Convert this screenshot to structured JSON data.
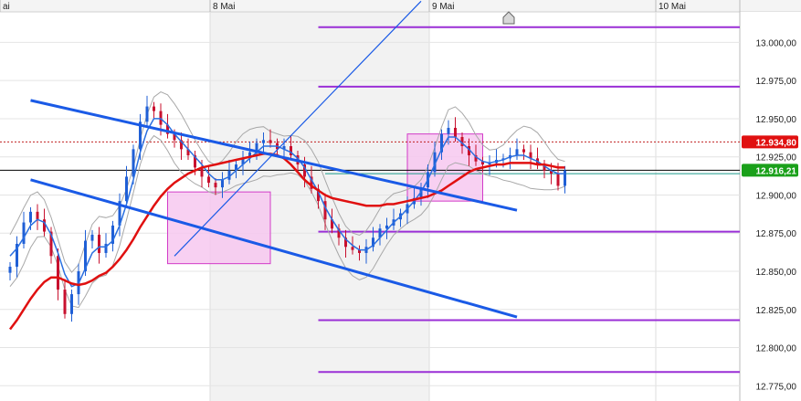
{
  "chart_data": {
    "type": "candlestick",
    "x_labels": [
      "ai",
      "8 Mai",
      "9 Mai",
      "10 Mai"
    ],
    "y_ticks": [
      "13.000,00",
      "12.975,00",
      "12.950,00",
      "12.925,00",
      "12.900,00",
      "12.875,00",
      "12.850,00",
      "12.825,00",
      "12.800,00",
      "12.775,00"
    ],
    "ylim": [
      12765,
      13020
    ],
    "current_price": 12916.21,
    "current_price_label": "12.916,21",
    "marker_price": 12934.8,
    "marker_price_label": "12.934,80",
    "grid": true,
    "colors": {
      "up_candle": "#1f5fd6",
      "down_candle": "#c8102e",
      "moving_average_slow": "#e01010",
      "moving_average_fast": "#2a6fe0",
      "bollinger_band": "#a8a8a8",
      "trend_channel": "#1a5ae6",
      "fib_levels": "#9a2fd6",
      "rectangle_fill": "#f7c8f0",
      "rectangle_stroke": "#d23cc8",
      "current_price_badge": "#1aa01a",
      "marker_badge": "#e01010"
    },
    "series": {
      "close": [
        12853,
        12868,
        12882,
        12889,
        12884,
        12876,
        12860,
        12838,
        12822,
        12835,
        12850,
        12870,
        12874,
        12862,
        12868,
        12880,
        12896,
        12912,
        12930,
        12948,
        12958,
        12955,
        12946,
        12940,
        12936,
        12930,
        12926,
        12918,
        12912,
        12908,
        12905,
        12910,
        12916,
        12920,
        12924,
        12928,
        12934,
        12936,
        12934,
        12930,
        12932,
        12926,
        12920,
        12912,
        12904,
        12896,
        12884,
        12878,
        12872,
        12866,
        12864,
        12862,
        12866,
        12872,
        12878,
        12880,
        12884,
        12888,
        12894,
        12898,
        12905,
        12915,
        12928,
        12940,
        12944,
        12938,
        12932,
        12926,
        12922,
        12920,
        12921,
        12923,
        12924,
        12926,
        12930,
        12928,
        12924,
        12920,
        12916,
        12914,
        12906,
        12916
      ],
      "ma_fast": [
        12860,
        12865,
        12872,
        12880,
        12884,
        12882,
        12874,
        12862,
        12848,
        12840,
        12842,
        12852,
        12862,
        12866,
        12866,
        12870,
        12880,
        12894,
        12910,
        12928,
        12942,
        12950,
        12950,
        12946,
        12940,
        12935,
        12930,
        12925,
        12920,
        12914,
        12910,
        12910,
        12912,
        12916,
        12920,
        12924,
        12928,
        12932,
        12932,
        12932,
        12930,
        12928,
        12924,
        12918,
        12910,
        12902,
        12892,
        12884,
        12877,
        12871,
        12867,
        12864,
        12864,
        12867,
        12872,
        12877,
        12882,
        12886,
        12891,
        12896,
        12902,
        12910,
        12920,
        12930,
        12938,
        12938,
        12934,
        12930,
        12925,
        12922,
        12921,
        12922,
        12923,
        12925,
        12926,
        12926,
        12924,
        12922,
        12919,
        12916,
        12914,
        12914
      ],
      "ma_slow": [
        12812,
        12818,
        12825,
        12832,
        12838,
        12843,
        12846,
        12846,
        12844,
        12842,
        12841,
        12842,
        12844,
        12847,
        12849,
        12853,
        12858,
        12864,
        12871,
        12879,
        12886,
        12893,
        12899,
        12904,
        12908,
        12911,
        12914,
        12916,
        12918,
        12919,
        12920,
        12921,
        12922,
        12923,
        12924,
        12925,
        12926,
        12927,
        12927,
        12926,
        12924,
        12920,
        12915,
        12910,
        12906,
        12903,
        12900,
        12898,
        12897,
        12896,
        12895,
        12894,
        12893,
        12893,
        12893,
        12894,
        12894,
        12895,
        12896,
        12897,
        12898,
        12899,
        12901,
        12903,
        12906,
        12909,
        12912,
        12915,
        12917,
        12918,
        12919,
        12920,
        12920,
        12921,
        12921,
        12921,
        12921,
        12920,
        12920,
        12919,
        12918,
        12918
      ]
    },
    "trend_lines": [
      {
        "p1": [
          3,
          12962
        ],
        "p2": [
          74,
          12890
        ]
      },
      {
        "p1": [
          3,
          12910
        ],
        "p2": [
          74,
          12820
        ]
      },
      {
        "p1": [
          24,
          12860
        ],
        "p2": [
          60,
          13027
        ]
      }
    ],
    "fib_levels": [
      13010,
      12971,
      12876,
      12818,
      12784
    ],
    "fib_x_range": [
      45,
      74
    ],
    "horizontal_lines": [
      {
        "price": 12914,
        "x_range": [
          46,
          74
        ],
        "color": "#1a9a8a"
      },
      {
        "price": 12916.21,
        "x_range": [
          -10,
          74
        ],
        "color": "#000000"
      },
      {
        "price": 12934.8,
        "x_range": [
          -10,
          74
        ],
        "color": "#c02020",
        "dashed": true
      }
    ],
    "rectangles": [
      {
        "x_range": [
          23,
          38
        ],
        "y_range": [
          12855,
          12902
        ]
      },
      {
        "x_range": [
          58,
          69
        ],
        "y_range": [
          12896,
          12940
        ]
      }
    ]
  }
}
